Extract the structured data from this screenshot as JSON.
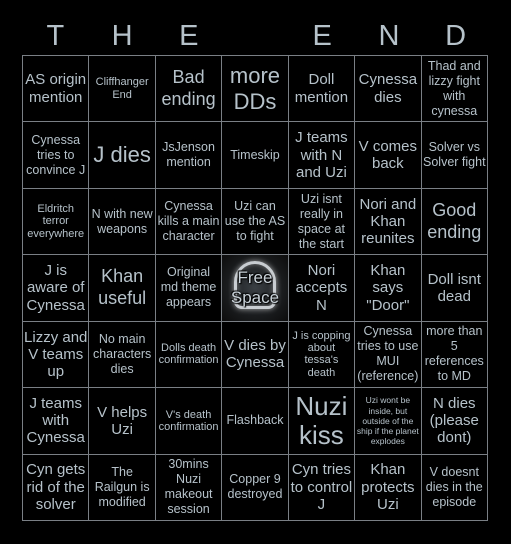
{
  "header": {
    "letters": [
      "T",
      "H",
      "E",
      "",
      "E",
      "N",
      "D"
    ]
  },
  "colors": {
    "background": "#000000",
    "text": "#b6c2ca",
    "grid_line": "#7a7f85"
  },
  "board": {
    "free_space": {
      "label": "Free Space",
      "icon": "skull-icon"
    },
    "rows": [
      [
        "AS origin mention",
        "Cliffhanger End",
        "Bad ending",
        "more DDs",
        "Doll mention",
        "Cynessa dies",
        "Thad and lizzy fight with cynessa"
      ],
      [
        "Cynessa tries to convince J",
        "J dies",
        "JsJenson mention",
        "Timeskip",
        "J teams with N and Uzi",
        "V comes back",
        "Solver vs Solver fight"
      ],
      [
        "Eldritch terror everywhere",
        "N with new weapons",
        "Cynessa kills a main character",
        "Uzi can use the AS to fight",
        "Uzi isnt really in space at the start",
        "Nori and Khan reunites",
        "Good ending"
      ],
      [
        "J is aware of Cynessa",
        "Khan useful",
        "Original md theme appears",
        "Free Space",
        "Nori accepts N",
        "Khan says \"Door\"",
        "Doll isnt dead"
      ],
      [
        "Lizzy and V teams up",
        "No main characters dies",
        "Dolls death confirmation",
        "V dies by Cynessa",
        "J is copping about tessa's death",
        "Cynessa tries to use MUI (reference)",
        "more than 5 references to MD"
      ],
      [
        "J teams with Cynessa",
        "V helps Uzi",
        "V's death confirmation",
        "Flashback",
        "Nuzi kiss",
        "Uzi wont be inside, but outside of the ship if the planet explodes",
        "N dies (please dont)"
      ],
      [
        "Cyn gets rid of the solver",
        "The Railgun is modified",
        "30mins Nuzi makeout session",
        "Copper 9 destroyed",
        "Cyn tries to control J",
        "Khan protects Uzi",
        "V doesnt dies in the episode"
      ]
    ]
  }
}
